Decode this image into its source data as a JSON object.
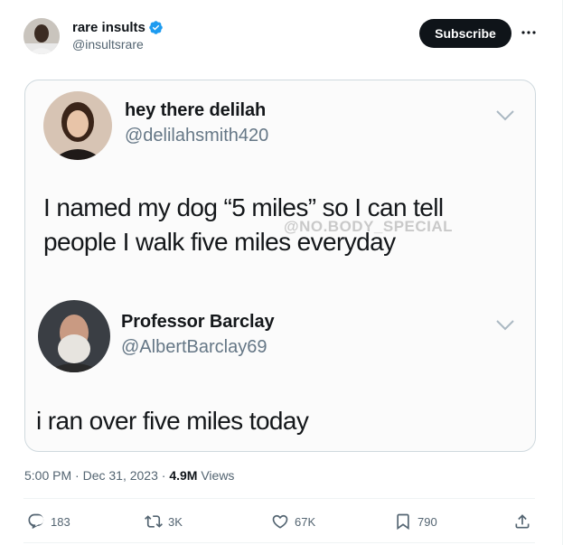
{
  "author": {
    "name": "rare insults",
    "handle": "@insultsrare",
    "verified": true
  },
  "header": {
    "subscribe_label": "Subscribe",
    "more_label": "···"
  },
  "media": {
    "watermark": "@NO.BODY_SPECIAL",
    "first_tweet": {
      "name": "hey there delilah",
      "handle": "@delilahsmith420",
      "text_line1": "I named my dog “5 miles” so I can tell",
      "text_line2": "people I walk five miles everyday"
    },
    "reply_tweet": {
      "name": "Professor Barclay",
      "handle": "@AlbertBarclay69",
      "text": "i ran over five miles today"
    }
  },
  "meta": {
    "time": "5:00 PM",
    "sep1": "·",
    "date": "Dec 31, 2023",
    "sep2": "·",
    "views_count": "4.9M",
    "views_label": "Views"
  },
  "actions": {
    "replies": "183",
    "reposts": "3K",
    "likes": "67K",
    "bookmarks": "790"
  },
  "colors": {
    "verified_blue": "#1d9bf0",
    "subscribe_bg": "#0f1419",
    "muted": "#536471"
  }
}
